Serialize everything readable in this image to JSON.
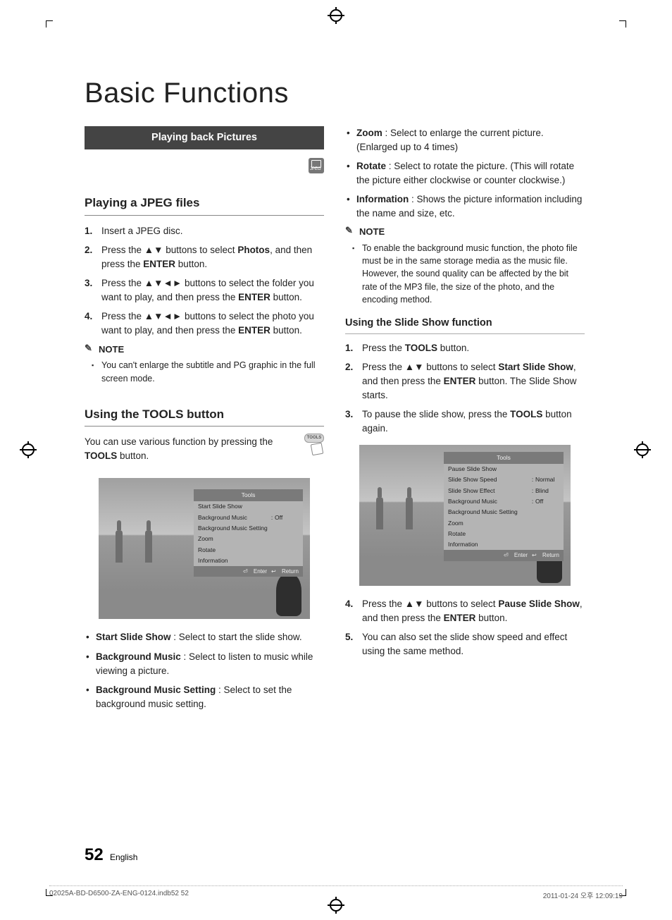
{
  "page": {
    "title": "Basic Functions",
    "number": "52",
    "lang": "English"
  },
  "printline": {
    "file": "02025A-BD-D6500-ZA-ENG-0124.indb52   52",
    "date": "2011-01-24   오후 12:09:19"
  },
  "left": {
    "bar_heading": "Playing back Pictures",
    "jpeg_badge": "JPEG",
    "h2_playing": "Playing a JPEG files",
    "steps_playing": [
      {
        "n": "1.",
        "html": "Insert a JPEG disc."
      },
      {
        "n": "2.",
        "html": "Press the ▲▼ buttons to select <b>Photos</b>, and then press the <b>ENTER</b> button."
      },
      {
        "n": "3.",
        "html": "Press the ▲▼◄► buttons to select the folder you want to play, and then press the <b>ENTER</b> button."
      },
      {
        "n": "4.",
        "html": "Press the ▲▼◄► buttons to select the photo you want to play, and then press the <b>ENTER</b> button."
      }
    ],
    "note_label": "NOTE",
    "note_items": [
      "You can't enlarge the subtitle and PG graphic in the full screen mode."
    ],
    "h2_tools": "Using the TOOLS button",
    "tools_intro": "You can use various function by pressing the <b>TOOLS</b> button.",
    "tools_btn_label": "TOOLS",
    "osd1": {
      "header": "Tools",
      "rows": [
        {
          "k": "Start Slide Show"
        },
        {
          "k": "Background Music",
          "c": ":",
          "v": "Off"
        },
        {
          "k": "Background Music Setting"
        },
        {
          "k": "Zoom"
        },
        {
          "k": "Rotate"
        },
        {
          "k": "Information"
        }
      ],
      "footer_enter": "Enter",
      "footer_return": "Return"
    },
    "tools_bullets": [
      {
        "lead": "Start Slide Show",
        "rest": " : Select to start the slide show."
      },
      {
        "lead": "Background Music",
        "rest": " : Select to listen to music while viewing a picture."
      },
      {
        "lead": "Background Music Setting",
        "rest": " : Select to set the background music setting."
      }
    ]
  },
  "right": {
    "tools_bullets_cont": [
      {
        "lead": "Zoom",
        "rest": " : Select to enlarge the current picture. (Enlarged up to 4 times)"
      },
      {
        "lead": "Rotate",
        "rest": " : Select to rotate the picture. (This will rotate the picture either clockwise or counter clockwise.)"
      },
      {
        "lead": "Information",
        "rest": " : Shows the picture information including the name and size, etc."
      }
    ],
    "note_label": "NOTE",
    "note_items": [
      "To enable the background music function, the photo file must be in the same storage media as the music file. However, the sound quality can be affected by the bit rate of the MP3 file, the size of the photo, and the encoding method."
    ],
    "h3_slide": "Using the Slide Show function",
    "steps_slide_a": [
      {
        "n": "1.",
        "html": "Press the <b>TOOLS</b> button."
      },
      {
        "n": "2.",
        "html": "Press the ▲▼ buttons to select <b>Start Slide Show</b>, and then press the <b>ENTER</b> button. The Slide Show starts."
      },
      {
        "n": "3.",
        "html": "To pause the slide show, press the <b>TOOLS</b> button again."
      }
    ],
    "osd2": {
      "header": "Tools",
      "rows": [
        {
          "k": "Pause Slide Show"
        },
        {
          "k": "Slide Show Speed",
          "c": ":",
          "v": "Normal"
        },
        {
          "k": "Slide Show Effect",
          "c": ":",
          "v": "Blind"
        },
        {
          "k": "Background Music",
          "c": ":",
          "v": "Off"
        },
        {
          "k": "Background Music Setting"
        },
        {
          "k": "Zoom"
        },
        {
          "k": "Rotate"
        },
        {
          "k": "Information"
        }
      ],
      "footer_enter": "Enter",
      "footer_return": "Return"
    },
    "steps_slide_b": [
      {
        "n": "4.",
        "html": "Press the ▲▼ buttons to select <b>Pause Slide Show</b>, and then press the <b>ENTER</b> button."
      },
      {
        "n": "5.",
        "html": "You can also set the slide show speed and effect using the same method."
      }
    ]
  }
}
